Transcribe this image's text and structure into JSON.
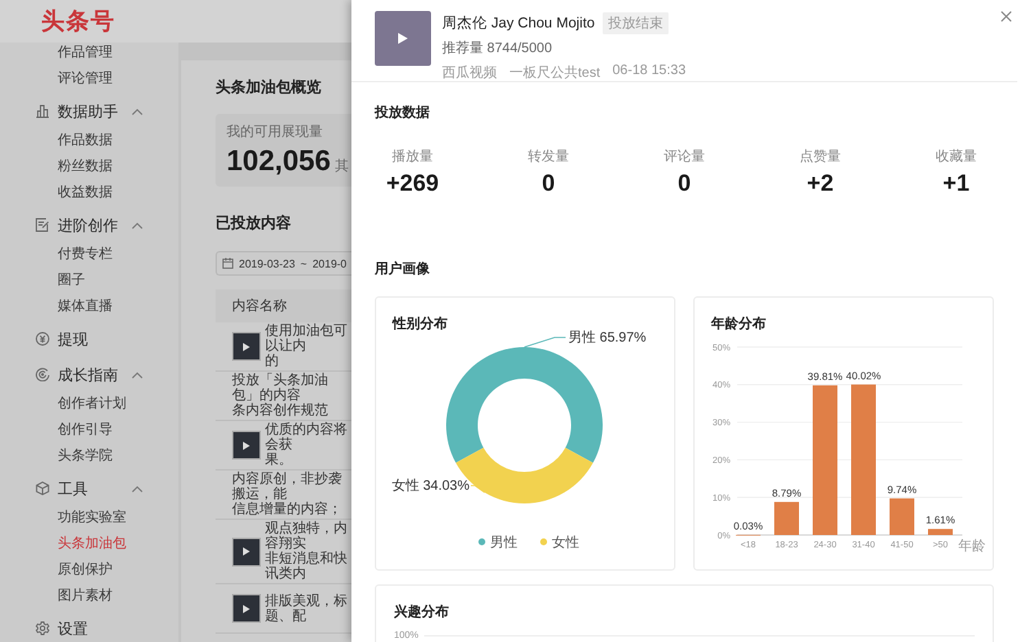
{
  "header": {
    "logo": "头条号"
  },
  "sidebar": {
    "groups": [
      {
        "children": [
          {
            "label": "作品管理",
            "selected": false
          },
          {
            "label": "评论管理",
            "selected": false
          }
        ]
      },
      {
        "label": "数据助手",
        "expanded": true,
        "children": [
          {
            "label": "作品数据",
            "selected": false
          },
          {
            "label": "粉丝数据",
            "selected": false
          },
          {
            "label": "收益数据",
            "selected": false
          }
        ]
      },
      {
        "label": "进阶创作",
        "expanded": true,
        "children": [
          {
            "label": "付费专栏",
            "selected": false
          },
          {
            "label": "圈子",
            "selected": false
          },
          {
            "label": "媒体直播",
            "selected": false
          }
        ]
      },
      {
        "label": "提现"
      },
      {
        "label": "成长指南",
        "expanded": true,
        "children": [
          {
            "label": "创作者计划",
            "selected": false
          },
          {
            "label": "创作引导",
            "selected": false
          },
          {
            "label": "头条学院",
            "selected": false
          }
        ]
      },
      {
        "label": "工具",
        "expanded": true,
        "children": [
          {
            "label": "功能实验室",
            "selected": false
          },
          {
            "label": "头条加油包",
            "selected": true
          },
          {
            "label": "原创保护",
            "selected": false
          },
          {
            "label": "图片素材",
            "selected": false
          }
        ]
      },
      {
        "label": "设置"
      }
    ]
  },
  "overview": {
    "title": "头条加油包概览",
    "label": "我的可用展现量",
    "value": "102,056",
    "note": "其"
  },
  "content": {
    "title": "已投放内容",
    "date_start": "2019-03-23",
    "date_sep": "~",
    "date_end": "2019-0",
    "table": {
      "columns": [
        "内容名称"
      ],
      "rows": [
        {
          "thumbnail": true,
          "lines": [
            "使用加油包可以让内",
            "的"
          ]
        },
        {
          "thumbnail": false,
          "lines": [
            "投放「头条加油包」的内容",
            "条内容创作规范"
          ]
        },
        {
          "thumbnail": true,
          "lines": [
            "优质的内容将会获",
            "果。"
          ]
        },
        {
          "thumbnail": false,
          "lines": [
            "内容原创，非抄袭搬运，能",
            "信息增量的内容；"
          ]
        },
        {
          "thumbnail": true,
          "lines": [
            "观点独特，内容翔实",
            "非短消息和快讯类内"
          ]
        },
        {
          "thumbnail": true,
          "lines": [
            "排版美观，标题、配"
          ]
        }
      ]
    }
  },
  "detail": {
    "title": "周杰伦 Jay Chou Mojito",
    "status": "投放结束",
    "recommend": "推荐量 8744/5000",
    "meta": [
      "西瓜视频",
      "一板尺公共test",
      "06-18 15:33"
    ]
  },
  "stats": {
    "title": "投放数据",
    "items": [
      {
        "label": "播放量",
        "value": "+269"
      },
      {
        "label": "转发量",
        "value": "0"
      },
      {
        "label": "评论量",
        "value": "0"
      },
      {
        "label": "点赞量",
        "value": "+2"
      },
      {
        "label": "收藏量",
        "value": "+1"
      }
    ]
  },
  "portrait": {
    "title": "用户画像",
    "gender": {
      "title": "性别分布",
      "chart_data": {
        "type": "donut",
        "categories": [
          "男性",
          "女性"
        ],
        "values": [
          65.97,
          34.03
        ],
        "value_labels": [
          "男性 65.97%",
          "女性 34.03%"
        ],
        "legend": {
          "items": [
            {
              "color": "#5bb8b8"
            },
            {
              "color": "#f2d24f"
            }
          ]
        }
      }
    },
    "age": {
      "title": "年龄分布",
      "chart_data": {
        "type": "bar",
        "categories": [
          "<18",
          "18-23",
          "24-30",
          "31-40",
          "41-50",
          ">50"
        ],
        "values": [
          0.03,
          8.79,
          39.81,
          40.02,
          9.74,
          1.61
        ],
        "value_labels": [
          "0.03%",
          "8.79%",
          "39.81%",
          "40.02%",
          "9.74%",
          "1.61%"
        ],
        "xlabel": "年龄",
        "ylim": [
          0,
          50
        ],
        "grid": true,
        "yticks": [
          {
            "value": 0,
            "label": "0%"
          },
          {
            "value": 10,
            "label": "10%"
          },
          {
            "value": 20,
            "label": "20%"
          },
          {
            "value": 30,
            "label": "30%"
          },
          {
            "value": 40,
            "label": "40%"
          },
          {
            "value": 50,
            "label": "50%"
          }
        ]
      }
    },
    "interest": {
      "title": "兴趣分布",
      "axis_label": "100%"
    }
  }
}
